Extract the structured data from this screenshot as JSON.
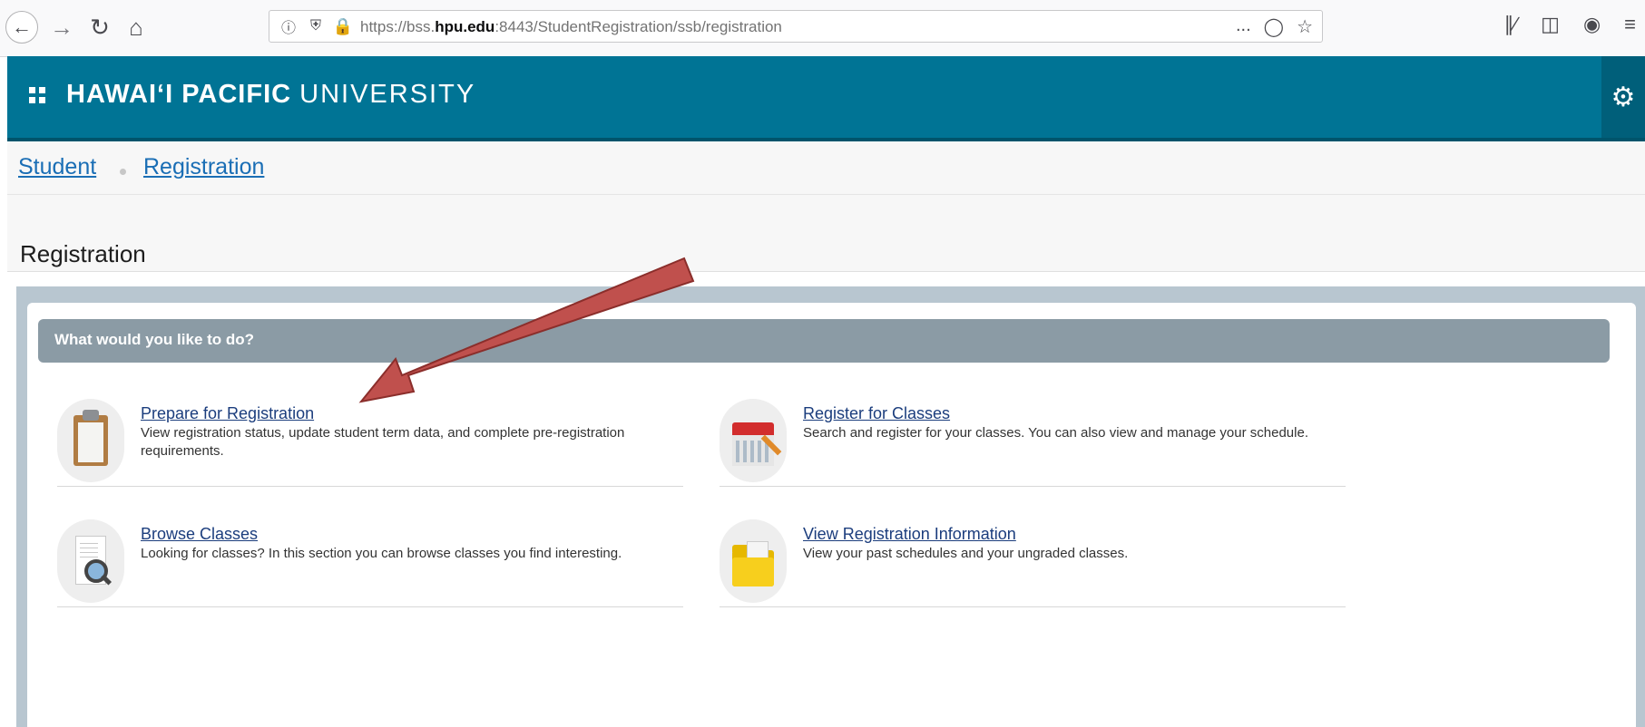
{
  "browser": {
    "url_domain_prefix": "https://bss.",
    "url_domain": "hpu.edu",
    "url_rest": ":8443/StudentRegistration/ssb/registration",
    "more_icon": "...",
    "colors": {
      "lock": "#12bc00"
    }
  },
  "header": {
    "brand_bold": "HAWAIʻI PACIFIC",
    "brand_light": "UNIVERSITY",
    "colors": {
      "band": "#007495",
      "gear_bg": "#005f7a"
    }
  },
  "breadcrumb": {
    "items": [
      "Student",
      "Registration"
    ]
  },
  "page": {
    "title": "Registration"
  },
  "panel": {
    "heading": "What would you like to do?",
    "actions": [
      {
        "label": "Prepare for Registration",
        "description": "View registration status, update student term data, and complete pre-registration requirements.",
        "icon": "clipboard-icon"
      },
      {
        "label": "Register for Classes",
        "description": "Search and register for your classes. You can also view and manage your schedule.",
        "icon": "calendar-icon"
      },
      {
        "label": "Browse Classes",
        "description": "Looking for classes? In this section you can browse classes you find interesting.",
        "icon": "document-search-icon"
      },
      {
        "label": "View Registration Information",
        "description": "View your past schedules and your ungraded classes.",
        "icon": "folder-icon"
      }
    ]
  },
  "annotation": {
    "arrow_color": "#c0504d"
  }
}
